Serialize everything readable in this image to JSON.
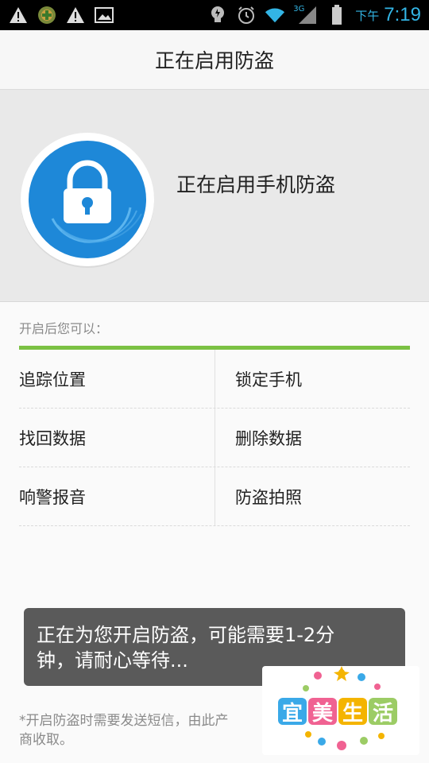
{
  "status_bar": {
    "icons_left": [
      "warning-icon",
      "game-app-icon",
      "warning-icon",
      "image-icon"
    ],
    "icons_right": [
      "bulb-icon",
      "alarm-icon",
      "wifi-icon",
      "signal-3g-icon",
      "battery-icon"
    ],
    "network_label": "3G",
    "ampm": "下午",
    "time": "7:19",
    "accent_color": "#33b5e5"
  },
  "titlebar": {
    "title": "正在启用防盗"
  },
  "hero": {
    "text": "正在启用手机防盗",
    "badge_color": "#1e88d8"
  },
  "features": {
    "caption": "开启后您可以：",
    "accent_color": "#7bc143",
    "rows": [
      {
        "left": "追踪位置",
        "right": "锁定手机"
      },
      {
        "left": "找回数据",
        "right": "删除数据"
      },
      {
        "left": "响警报音",
        "right": "防盗拍照"
      }
    ]
  },
  "toast": {
    "line1": "正在为您开启防盗，可能需要1-2分",
    "line2": "钟，请耐心等待..."
  },
  "footnote": {
    "line1": "*开启防盗时需要发送短信，由此产",
    "line2": "商收取。"
  },
  "watermark": {
    "chars": [
      "宜",
      "美",
      "生",
      "活"
    ],
    "colors": [
      "#3aa9e8",
      "#f06292",
      "#f4b400",
      "#9ccc65"
    ]
  }
}
